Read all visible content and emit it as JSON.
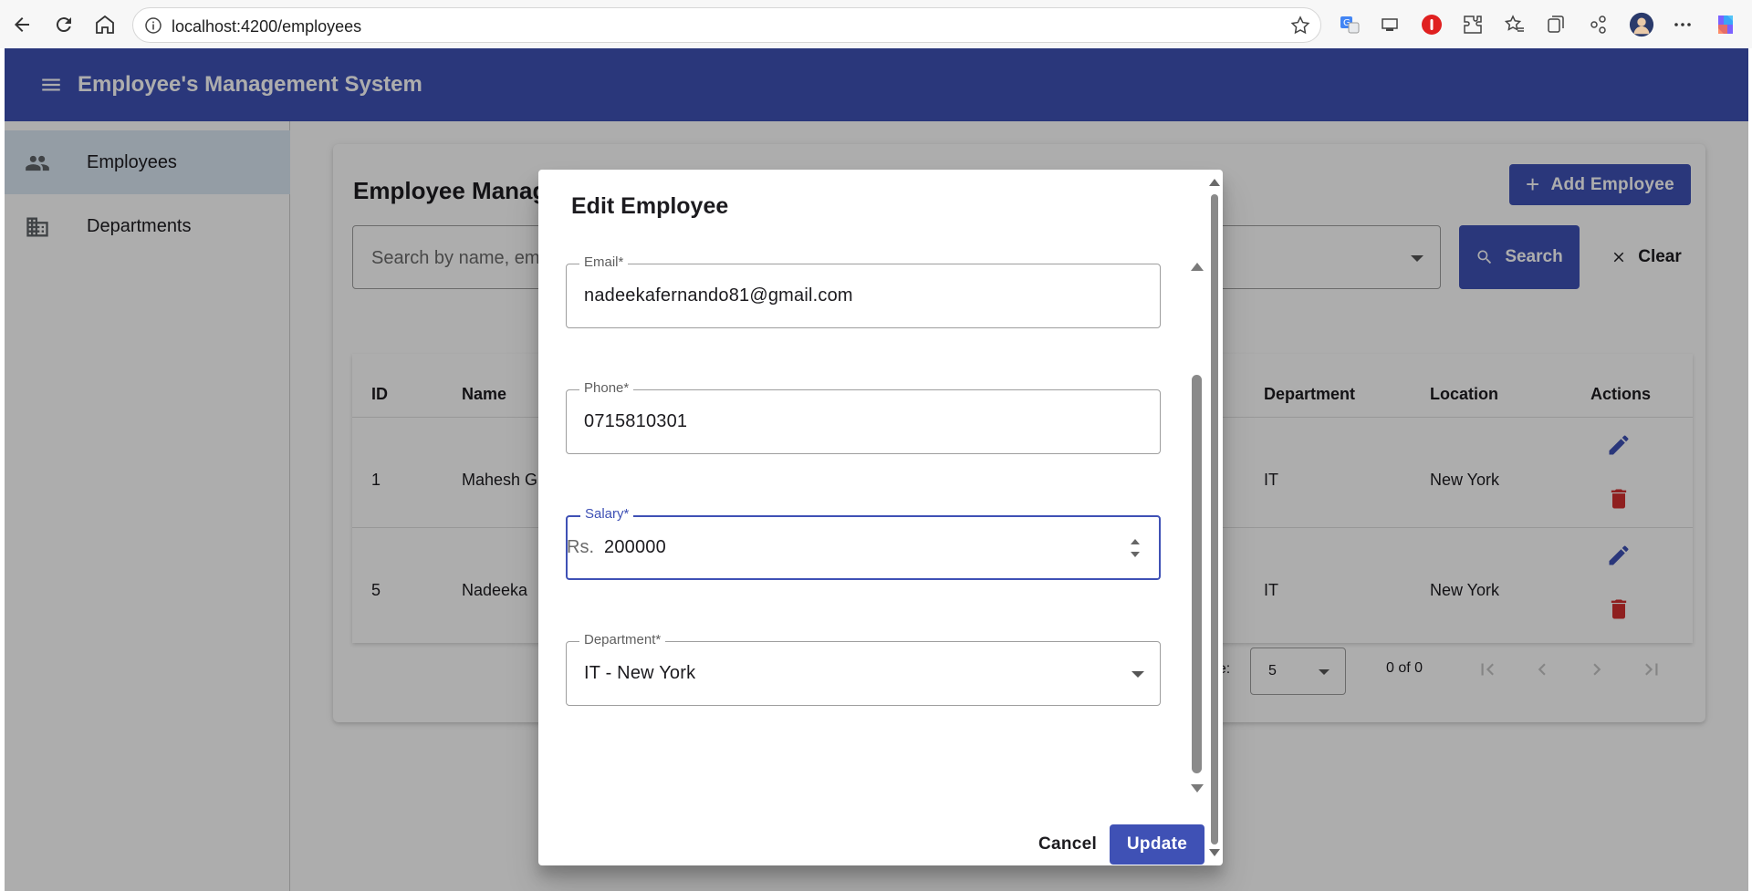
{
  "browser": {
    "url": "localhost:4200/employees"
  },
  "app": {
    "title": "Employee's Management System"
  },
  "sidenav": {
    "items": [
      {
        "label": "Employees",
        "icon": "people-icon",
        "active": true
      },
      {
        "label": "Departments",
        "icon": "building-icon",
        "active": false
      }
    ]
  },
  "page": {
    "title": "Employee Manage",
    "add_button": "Add Employee",
    "search_placeholder": "Search by name, em",
    "search_button": "Search",
    "clear_button": "Clear"
  },
  "table": {
    "headers": [
      "ID",
      "Name",
      "Department",
      "Location",
      "Actions"
    ],
    "rows": [
      {
        "id": "1",
        "name": "Mahesh G",
        "department": "IT",
        "location": "New York"
      },
      {
        "id": "5",
        "name": "Nadeeka",
        "department": "IT",
        "location": "New York"
      }
    ]
  },
  "paginator": {
    "label": "ge:",
    "page_size": "5",
    "range": "0 of 0"
  },
  "dialog": {
    "title": "Edit Employee",
    "fields": {
      "email": {
        "label": "Email*",
        "value": "nadeekafernando81@gmail.com"
      },
      "phone": {
        "label": "Phone*",
        "value": "0715810301"
      },
      "salary": {
        "label": "Salary*",
        "prefix": "Rs.",
        "value": "200000"
      },
      "department": {
        "label": "Department*",
        "value": "IT - New York"
      }
    },
    "cancel_button": "Cancel",
    "update_button": "Update"
  },
  "colors": {
    "primary": "#3f51b5",
    "delete": "#d32f2f",
    "active_nav": "#dbe8f4"
  }
}
